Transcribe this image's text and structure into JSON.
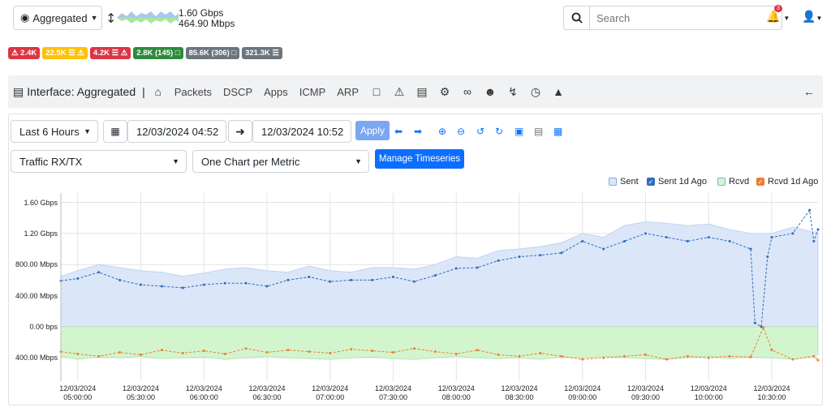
{
  "top": {
    "interface_label": "Aggregated",
    "throughput_primary": "1.60 Gbps",
    "throughput_secondary": "464.90 Mbps",
    "search_placeholder": "Search",
    "notification_count": "3"
  },
  "badges": [
    {
      "text": "⚠ 2.4K",
      "color": "red"
    },
    {
      "text": "22.5K ☰ ⚠",
      "color": "yellow"
    },
    {
      "text": "4.2K ☰ ⚠",
      "color": "red"
    },
    {
      "text": "2.8K (145) □",
      "color": "green"
    },
    {
      "text": "85.6K (306) □",
      "color": "gray"
    },
    {
      "text": "321.3K ☰",
      "color": "gray"
    }
  ],
  "nav": {
    "title": "Interface: Aggregated",
    "links": [
      "Packets",
      "DSCP",
      "Apps",
      "ICMP",
      "ARP"
    ],
    "icons": [
      "chart-area-icon",
      "warning-icon",
      "file-icon",
      "gear-icon",
      "wrench-icon",
      "user-slash-icon",
      "bolt-icon",
      "clock-icon",
      "bell-concierge-icon"
    ]
  },
  "controls": {
    "range": "Last 6 Hours",
    "start": "12/03/2024 04:52",
    "end": "12/03/2024 10:52",
    "apply": "Apply",
    "metric": "Traffic RX/TX",
    "layout": "One Chart per Metric",
    "manage": "Manage Timeseries"
  },
  "legend": [
    {
      "label": "Sent",
      "color": "#dbe6f9",
      "checked": false
    },
    {
      "label": "Sent 1d Ago",
      "color": "#2f6db8",
      "checked": true
    },
    {
      "label": "Rcvd",
      "color": "#d3f5cd",
      "checked": false
    },
    {
      "label": "Rcvd 1d Ago",
      "color": "#f07b32",
      "checked": true
    }
  ],
  "chart_data": {
    "type": "area",
    "ylabel": "",
    "xlabel": "",
    "y_ticks": [
      "1.60 Gbps",
      "1.20 Gbps",
      "800.00 Mbps",
      "400.00 Mbps",
      "0.00 bps",
      "400.00 Mbps"
    ],
    "ylim_mbps": [
      -700,
      1720
    ],
    "x_ticks": [
      [
        "12/03/2024",
        "05:00:00"
      ],
      [
        "12/03/2024",
        "05:30:00"
      ],
      [
        "12/03/2024",
        "06:00:00"
      ],
      [
        "12/03/2024",
        "06:30:00"
      ],
      [
        "12/03/2024",
        "07:00:00"
      ],
      [
        "12/03/2024",
        "07:30:00"
      ],
      [
        "12/03/2024",
        "08:00:00"
      ],
      [
        "12/03/2024",
        "08:30:00"
      ],
      [
        "12/03/2024",
        "09:00:00"
      ],
      [
        "12/03/2024",
        "09:30:00"
      ],
      [
        "12/03/2024",
        "10:00:00"
      ],
      [
        "12/03/2024",
        "10:30:00"
      ]
    ],
    "x_range_minutes": [
      292,
      652
    ],
    "series": [
      {
        "name": "Sent",
        "x_minutes": [
          292,
          300,
          310,
          320,
          330,
          340,
          350,
          360,
          370,
          380,
          390,
          400,
          410,
          420,
          430,
          440,
          450,
          460,
          470,
          480,
          490,
          500,
          510,
          520,
          530,
          540,
          550,
          560,
          570,
          580,
          590,
          600,
          610,
          620,
          630,
          640,
          650,
          652
        ],
        "mbps": [
          650,
          720,
          800,
          760,
          720,
          700,
          650,
          690,
          740,
          760,
          720,
          700,
          780,
          720,
          700,
          760,
          760,
          740,
          800,
          900,
          880,
          980,
          1000,
          1030,
          1080,
          1200,
          1150,
          1300,
          1350,
          1330,
          1300,
          1320,
          1250,
          1200,
          1200,
          1280,
          1220,
          1220
        ]
      },
      {
        "name": "Sent 1d Ago",
        "x_minutes": [
          292,
          300,
          310,
          320,
          330,
          340,
          350,
          360,
          370,
          380,
          390,
          400,
          410,
          420,
          430,
          440,
          450,
          460,
          470,
          480,
          490,
          500,
          510,
          520,
          530,
          540,
          550,
          560,
          570,
          580,
          590,
          600,
          610,
          620,
          622,
          625,
          628,
          630,
          640,
          648,
          650,
          652
        ],
        "mbps": [
          590,
          620,
          700,
          600,
          540,
          520,
          500,
          540,
          560,
          560,
          520,
          600,
          640,
          580,
          600,
          600,
          640,
          580,
          660,
          750,
          760,
          850,
          900,
          920,
          950,
          1100,
          1000,
          1100,
          1200,
          1150,
          1100,
          1150,
          1100,
          1000,
          50,
          0,
          900,
          1150,
          1200,
          1500,
          1100,
          1250
        ]
      },
      {
        "name": "Rcvd",
        "x_minutes": [
          292,
          300,
          310,
          320,
          330,
          340,
          350,
          360,
          370,
          380,
          390,
          400,
          410,
          420,
          430,
          440,
          450,
          460,
          470,
          480,
          490,
          500,
          510,
          520,
          530,
          540,
          550,
          560,
          570,
          580,
          590,
          600,
          610,
          620,
          630,
          640,
          650,
          652
        ],
        "mbps": [
          -380,
          -420,
          -390,
          -400,
          -380,
          -410,
          -400,
          -390,
          -420,
          -400,
          -380,
          -400,
          -410,
          -420,
          -400,
          -390,
          -410,
          -420,
          -400,
          -380,
          -400,
          -410,
          -400,
          -420,
          -390,
          -400,
          -380,
          -400,
          -410,
          -420,
          -400,
          -380,
          -410,
          -390,
          -400,
          -420,
          -380,
          -360
        ]
      },
      {
        "name": "Rcvd 1d Ago",
        "x_minutes": [
          292,
          300,
          310,
          320,
          330,
          340,
          350,
          360,
          370,
          380,
          390,
          400,
          410,
          420,
          430,
          440,
          450,
          460,
          470,
          480,
          490,
          500,
          510,
          520,
          530,
          540,
          550,
          560,
          570,
          580,
          590,
          600,
          610,
          620,
          626,
          630,
          640,
          650,
          652
        ],
        "mbps": [
          -320,
          -350,
          -380,
          -330,
          -360,
          -300,
          -340,
          -310,
          -350,
          -280,
          -330,
          -300,
          -320,
          -340,
          -290,
          -310,
          -330,
          -280,
          -320,
          -350,
          -300,
          -360,
          -380,
          -340,
          -380,
          -420,
          -400,
          -380,
          -360,
          -420,
          -380,
          -400,
          -380,
          -390,
          -10,
          -300,
          -420,
          -380,
          -430
        ]
      }
    ]
  }
}
